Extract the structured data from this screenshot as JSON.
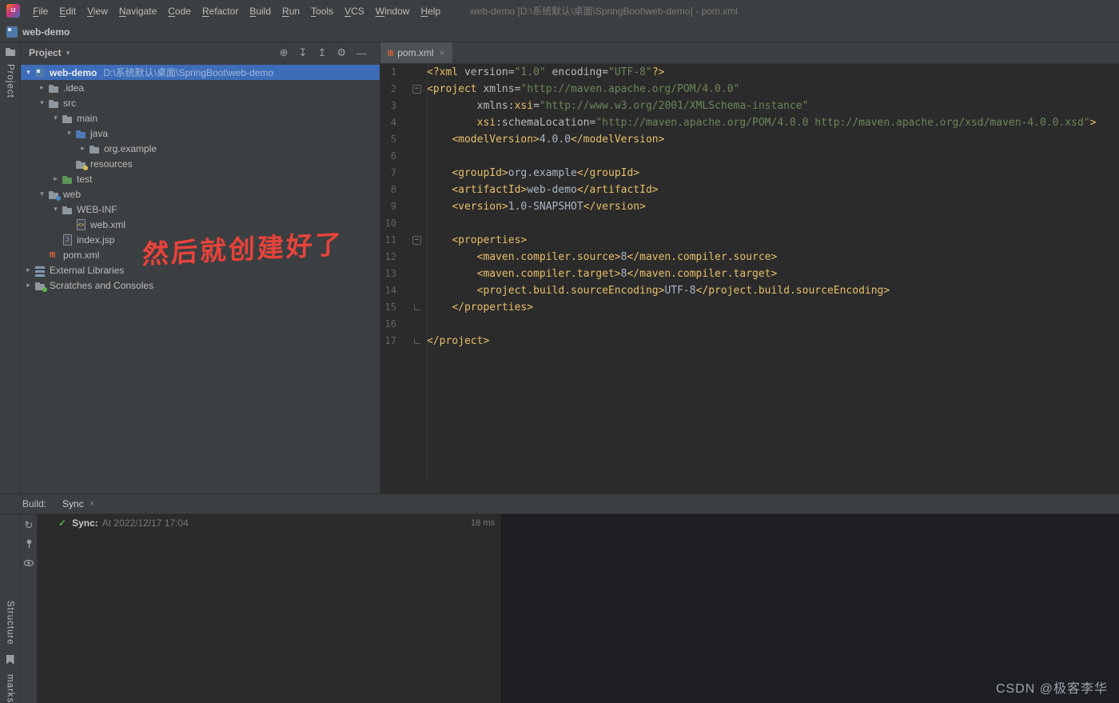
{
  "colors": {
    "panel_bg": "#3c3f41",
    "editor_bg": "#2b2b2b",
    "console_bg": "#1e1f22",
    "selection_blue": "#3d6cb8",
    "xml_tag": "#e8bf6a",
    "xml_attr": "#bababa",
    "xml_string": "#6a8759",
    "xml_text": "#a9b7c6",
    "line_number": "#606366",
    "annotation_red": "#e8433b",
    "sync_green": "#4db24d"
  },
  "glyphs": {
    "maven_m": "m",
    "caret_down": "▾",
    "chevron_down": "▾",
    "chevron_right": "▸",
    "fold_collapse": "−",
    "sync_arrow": "↻",
    "check": "✓"
  },
  "menu_bar": {
    "logo": "IJ",
    "items": [
      "File",
      "Edit",
      "View",
      "Navigate",
      "Code",
      "Refactor",
      "Build",
      "Run",
      "Tools",
      "VCS",
      "Window",
      "Help"
    ],
    "window_title": "web-demo [D:\\系统默认\\桌面\\SpringBoot\\web-demo] - pom.xml"
  },
  "toolbar": {
    "project_name": "web-demo"
  },
  "tool_stripes": {
    "top_left": "Project",
    "bottom_left": [
      "Structure",
      "marks"
    ]
  },
  "project_panel": {
    "header": {
      "title": "Project",
      "icons": [
        {
          "name": "locate-icon",
          "glyph": "⊕"
        },
        {
          "name": "expand-all-icon",
          "glyph": "↧"
        },
        {
          "name": "collapse-all-icon",
          "glyph": "↥"
        },
        {
          "name": "settings-gear-icon",
          "glyph": "⚙"
        },
        {
          "name": "hide-panel-icon",
          "glyph": "—"
        }
      ]
    },
    "tree": [
      {
        "label": "web-demo",
        "path_suffix": "D:\\系统默认\\桌面\\SpringBoot\\web-demo",
        "indent": 0,
        "chevron": "down",
        "icon": "project",
        "selected": true,
        "bold": true
      },
      {
        "label": ".idea",
        "indent": 1,
        "chevron": "right",
        "icon": "folder"
      },
      {
        "label": "src",
        "indent": 1,
        "chevron": "down",
        "icon": "folder"
      },
      {
        "label": "main",
        "indent": 2,
        "chevron": "down",
        "icon": "folder"
      },
      {
        "label": "java",
        "indent": 3,
        "chevron": "down",
        "icon": "java-source-folder"
      },
      {
        "label": "org.example",
        "indent": 4,
        "chevron": "right",
        "icon": "package"
      },
      {
        "label": "resources",
        "indent": 3,
        "chevron": "none",
        "icon": "resources-folder"
      },
      {
        "label": "test",
        "indent": 2,
        "chevron": "right",
        "icon": "test-folder"
      },
      {
        "label": "web",
        "indent": 1,
        "chevron": "down",
        "icon": "web-folder"
      },
      {
        "label": "WEB-INF",
        "indent": 2,
        "chevron": "down",
        "icon": "folder"
      },
      {
        "label": "web.xml",
        "indent": 3,
        "chevron": "none",
        "icon": "xml-file"
      },
      {
        "label": "index.jsp",
        "indent": 2,
        "chevron": "none",
        "icon": "jsp-file"
      },
      {
        "label": "pom.xml",
        "indent": 1,
        "chevron": "none",
        "icon": "maven-file"
      },
      {
        "label": "External Libraries",
        "indent": 0,
        "chevron": "right",
        "icon": "libraries"
      },
      {
        "label": "Scratches and Consoles",
        "indent": 0,
        "chevron": "right",
        "icon": "scratches"
      }
    ],
    "annotation": "然后就创建好了"
  },
  "editor": {
    "tab": {
      "label": "pom.xml",
      "close": "×"
    },
    "lines": [
      {
        "n": 1,
        "tokens": [
          [
            "tag",
            "<?xml "
          ],
          [
            "attr",
            "version="
          ],
          [
            "str",
            "\"1.0\""
          ],
          [
            "attr",
            " encoding="
          ],
          [
            "str",
            "\"UTF-8\""
          ],
          [
            "tag",
            "?>"
          ]
        ]
      },
      {
        "n": 2,
        "fold": "start",
        "tokens": [
          [
            "tag",
            "<project "
          ],
          [
            "attr",
            "xmlns="
          ],
          [
            "str",
            "\"http://maven.apache.org/POM/4.0.0\""
          ]
        ]
      },
      {
        "n": 3,
        "tokens": [
          [
            "txt",
            "        "
          ],
          [
            "attr",
            "xmlns:"
          ],
          [
            "ns",
            "xsi"
          ],
          [
            "attr",
            "="
          ],
          [
            "str",
            "\"http://www.w3.org/2001/XMLSchema-instance\""
          ]
        ]
      },
      {
        "n": 4,
        "tokens": [
          [
            "txt",
            "        "
          ],
          [
            "ns",
            "xsi"
          ],
          [
            "attr",
            ":schemaLocation="
          ],
          [
            "str",
            "\"http://maven.apache.org/POM/4.0.0 http://maven.apache.org/xsd/maven-4.0.0.xsd\""
          ],
          [
            "tag",
            ">"
          ]
        ]
      },
      {
        "n": 5,
        "tokens": [
          [
            "txt",
            "    "
          ],
          [
            "tag",
            "<modelVersion>"
          ],
          [
            "txt",
            "4.0.0"
          ],
          [
            "tag",
            "</modelVersion>"
          ]
        ]
      },
      {
        "n": 6,
        "tokens": []
      },
      {
        "n": 7,
        "tokens": [
          [
            "txt",
            "    "
          ],
          [
            "tag",
            "<groupId>"
          ],
          [
            "txt",
            "org.example"
          ],
          [
            "tag",
            "</groupId>"
          ]
        ]
      },
      {
        "n": 8,
        "tokens": [
          [
            "txt",
            "    "
          ],
          [
            "tag",
            "<artifactId>"
          ],
          [
            "txt",
            "web-demo"
          ],
          [
            "tag",
            "</artifactId>"
          ]
        ]
      },
      {
        "n": 9,
        "tokens": [
          [
            "txt",
            "    "
          ],
          [
            "tag",
            "<version>"
          ],
          [
            "txt",
            "1.0-SNAPSHOT"
          ],
          [
            "tag",
            "</version>"
          ]
        ]
      },
      {
        "n": 10,
        "tokens": []
      },
      {
        "n": 11,
        "fold": "start",
        "tokens": [
          [
            "txt",
            "    "
          ],
          [
            "tag",
            "<properties>"
          ]
        ]
      },
      {
        "n": 12,
        "tokens": [
          [
            "txt",
            "        "
          ],
          [
            "tag",
            "<maven.compiler.source>"
          ],
          [
            "txt",
            "8"
          ],
          [
            "tag",
            "</maven.compiler.source>"
          ]
        ]
      },
      {
        "n": 13,
        "tokens": [
          [
            "txt",
            "        "
          ],
          [
            "tag",
            "<maven.compiler.target>"
          ],
          [
            "txt",
            "8"
          ],
          [
            "tag",
            "</maven.compiler.target>"
          ]
        ]
      },
      {
        "n": 14,
        "tokens": [
          [
            "txt",
            "        "
          ],
          [
            "tag",
            "<project.build.sourceEncoding>"
          ],
          [
            "txt",
            "UTF-8"
          ],
          [
            "tag",
            "</project.build.sourceEncoding>"
          ]
        ]
      },
      {
        "n": 15,
        "fold": "end",
        "tokens": [
          [
            "txt",
            "    "
          ],
          [
            "tag",
            "</properties>"
          ]
        ]
      },
      {
        "n": 16,
        "tokens": []
      },
      {
        "n": 17,
        "fold": "end",
        "tokens": [
          [
            "tag",
            "</project>"
          ]
        ]
      }
    ]
  },
  "build_panel": {
    "label": "Build:",
    "tab": {
      "label": "Sync",
      "close": "×"
    },
    "result": {
      "check": "✓",
      "title": "Sync:",
      "detail": "At 2022/12/17 17:04",
      "duration": "18 ms"
    }
  },
  "watermark": "CSDN @极客李华"
}
